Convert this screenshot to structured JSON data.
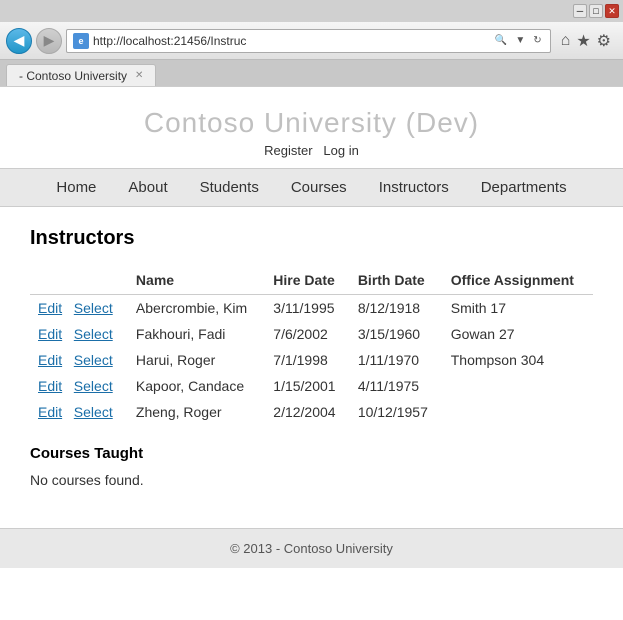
{
  "browser": {
    "url": "http://localhost:21456/Instruc",
    "tab_title": "- Contoso University",
    "minimize_label": "─",
    "maximize_label": "□",
    "close_label": "✕",
    "back_arrow": "◀",
    "forward_arrow": "▶",
    "home_icon": "⌂",
    "star_icon": "★",
    "gear_icon": "⚙"
  },
  "site": {
    "title": "Contoso University (Dev)",
    "auth": {
      "register": "Register",
      "login": "Log in"
    },
    "nav": [
      "Home",
      "About",
      "Students",
      "Courses",
      "Instructors",
      "Departments"
    ]
  },
  "page": {
    "heading": "Instructors",
    "table": {
      "columns": [
        "",
        "Name",
        "Hire Date",
        "Birth Date",
        "Office Assignment"
      ],
      "rows": [
        {
          "edit": "Edit",
          "select": "Select",
          "name": "Abercrombie, Kim",
          "hire_date": "3/11/1995",
          "birth_date": "8/12/1918",
          "office": "Smith 17"
        },
        {
          "edit": "Edit",
          "select": "Select",
          "name": "Fakhouri, Fadi",
          "hire_date": "7/6/2002",
          "birth_date": "3/15/1960",
          "office": "Gowan 27"
        },
        {
          "edit": "Edit",
          "select": "Select",
          "name": "Harui, Roger",
          "hire_date": "7/1/1998",
          "birth_date": "1/11/1970",
          "office": "Thompson 304"
        },
        {
          "edit": "Edit",
          "select": "Select",
          "name": "Kapoor, Candace",
          "hire_date": "1/15/2001",
          "birth_date": "4/11/1975",
          "office": ""
        },
        {
          "edit": "Edit",
          "select": "Select",
          "name": "Zheng, Roger",
          "hire_date": "2/12/2004",
          "birth_date": "10/12/1957",
          "office": ""
        }
      ]
    },
    "courses_heading": "Courses Taught",
    "no_courses": "No courses found."
  },
  "footer": {
    "text": "© 2013 - Contoso University"
  }
}
